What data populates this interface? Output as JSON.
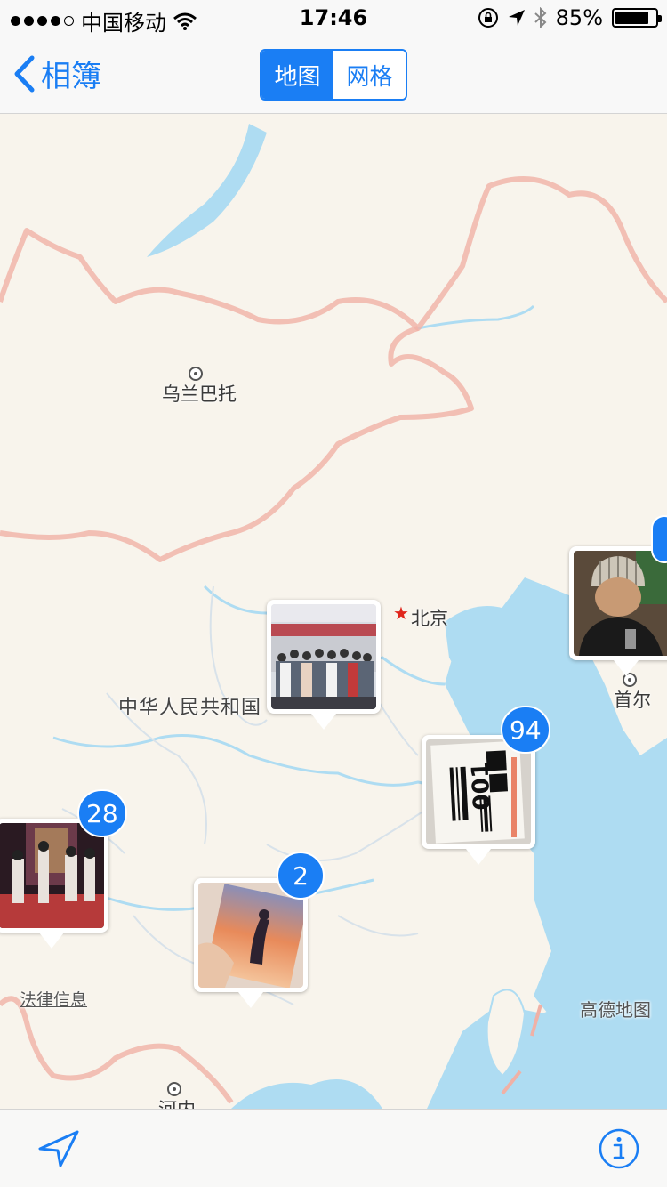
{
  "status": {
    "carrier": "中国移动",
    "time": "17:46",
    "battery": "85%",
    "battery_level": 0.85
  },
  "nav": {
    "back_label": "相簿",
    "segments": [
      "地图",
      "网格"
    ],
    "selected_segment": 0
  },
  "map": {
    "places": {
      "ulaanbaatar": "乌兰巴托",
      "beijing": "北京",
      "china": "中华人民共和国",
      "seoul": "首尔",
      "hanoi": "河内"
    },
    "legal": "法律信息",
    "brand": "高德地图"
  },
  "pins": [
    {
      "name": "beijing-area",
      "count": ""
    },
    {
      "name": "shanghai-area",
      "count": "94"
    },
    {
      "name": "southwest-area",
      "count": "28"
    },
    {
      "name": "south-area",
      "count": "2"
    },
    {
      "name": "seoul-area",
      "count": ""
    }
  ],
  "colors": {
    "accent": "#1a7ef4",
    "land": "#f8f4ec",
    "water": "#aedcf2",
    "border": "#f0b1a6"
  },
  "toolbar": {
    "left_icon": "location-arrow-icon",
    "right_icon": "info-icon"
  }
}
